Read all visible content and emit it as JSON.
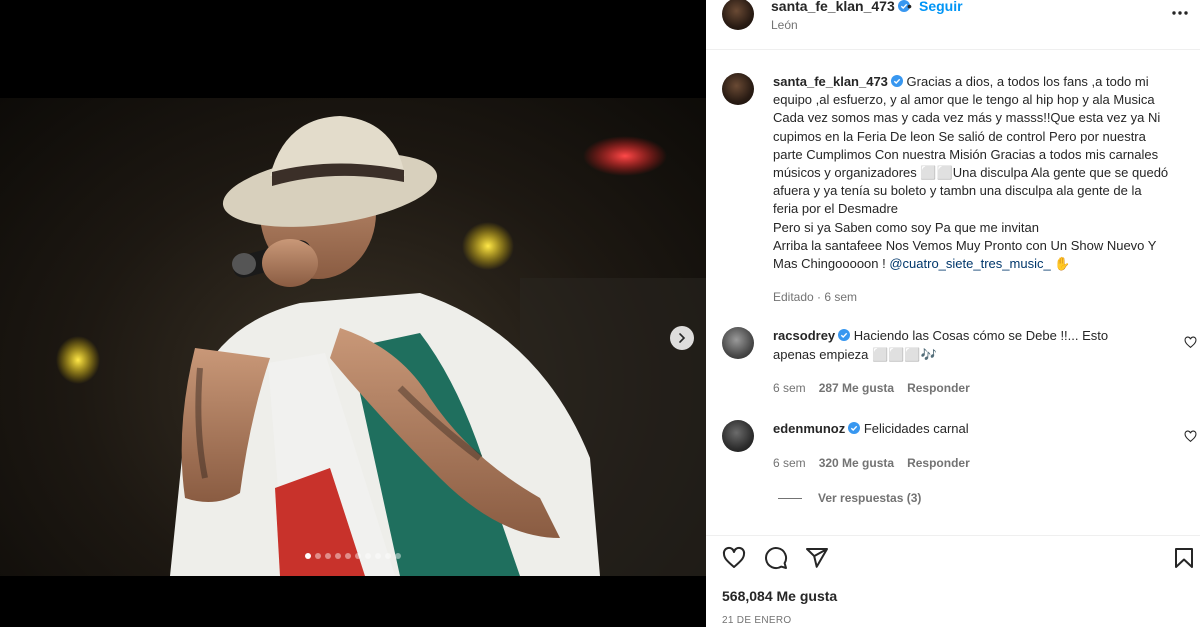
{
  "post": {
    "username": "santa_fe_klan_473",
    "follow_label": "Seguir",
    "separator": "•",
    "location": "León",
    "carousel_slide_count": 10,
    "carousel_active_index": 0
  },
  "caption": {
    "username": "santa_fe_klan_473",
    "lines": [
      "Gracias a dios, a todos los fans ,a todo mi",
      "equipo ,al esfuerzo, y al amor que le tengo al hip hop y ala Musica",
      "Cada vez somos mas y cada vez más y masss!!Que esta vez ya Ni",
      "cupimos en la Feria De leon Se salió de control Pero por nuestra",
      "parte Cumplimos Con nuestra Misión Gracias a todos mis carnales",
      "músicos y organizadores ⬜⬜Una disculpa Ala gente que se quedó",
      "afuera y ya tenía su boleto y tambn una disculpa ala gente de la",
      "feria por el Desmadre",
      "Pero si ya Saben como soy Pa que me invitan",
      "Arriba la santafeee Nos Vemos Muy Pronto con Un Show Nuevo Y"
    ],
    "last_line_prefix": "Mas Chingooooon ! ",
    "mention": "@cuatro_siete_tres_music_",
    "last_line_suffix": " ✋",
    "meta": "Editado · 6 sem"
  },
  "comments": [
    {
      "username": "racsodrey",
      "text_line1": "Haciendo las Cosas cómo se Debe !!... Esto",
      "text_line2": "apenas empieza ⬜⬜⬜🎶",
      "age": "6 sem",
      "likes": "287 Me gusta",
      "reply": "Responder"
    },
    {
      "username": "edenmunoz",
      "text_line1": "Felicidades carnal",
      "age": "6 sem",
      "likes": "320 Me gusta",
      "reply": "Responder"
    }
  ],
  "view_replies": "Ver respuestas (3)",
  "likes_count": "568,084 Me gusta",
  "date": "21 DE ENERO",
  "icons": {
    "verified": "verified-badge-icon",
    "more": "more-options-icon",
    "next": "chevron-right-icon",
    "like": "heart-icon",
    "comment": "comment-icon",
    "share": "send-icon",
    "save": "bookmark-icon"
  },
  "colors": {
    "accent": "#0095f6",
    "verified": "#3897f0",
    "mention": "#00376b",
    "secondary_text": "#737373"
  }
}
